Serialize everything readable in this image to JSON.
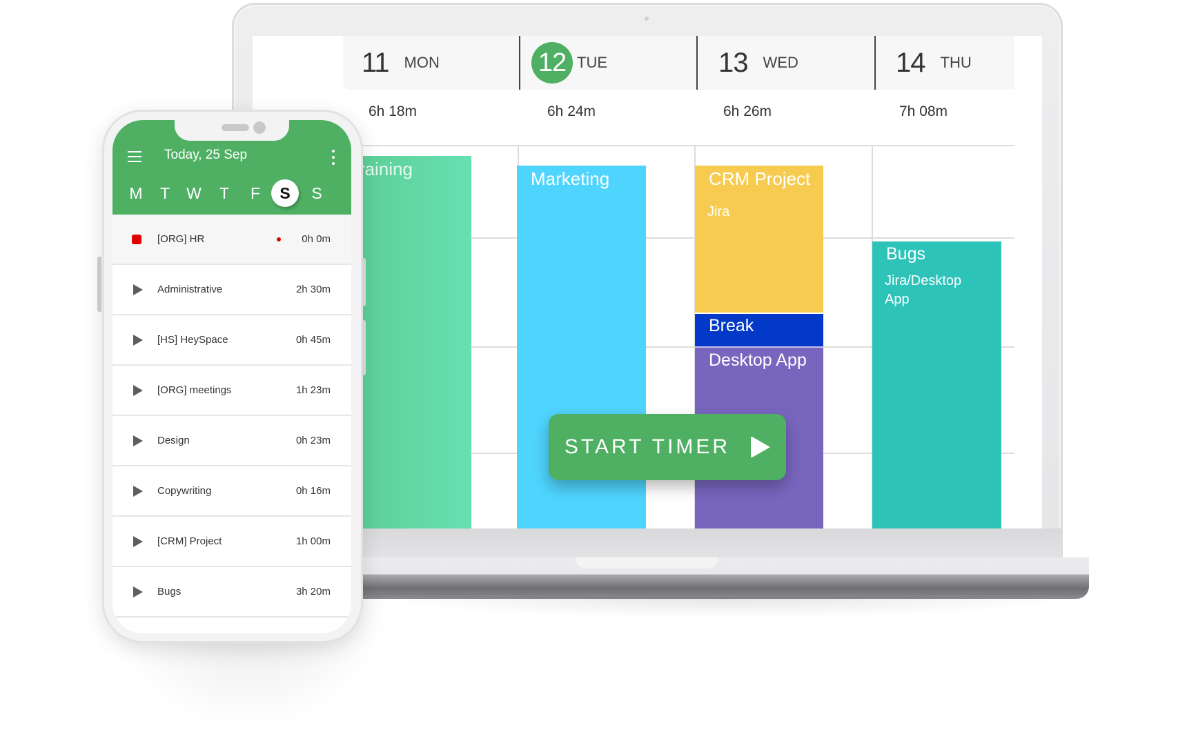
{
  "desktop": {
    "days": [
      {
        "num": "11",
        "name": "MON",
        "duration": "6h 18m",
        "today": false
      },
      {
        "num": "12",
        "name": "TUE",
        "duration": "6h 24m",
        "today": true
      },
      {
        "num": "13",
        "name": "WED",
        "duration": "6h 26m",
        "today": false
      },
      {
        "num": "14",
        "name": "THU",
        "duration": "7h 08m",
        "today": false
      }
    ],
    "blocks": [
      {
        "title": "Training",
        "subtitle": "",
        "color": "#67e0b0"
      },
      {
        "title": "Marketing",
        "subtitle": "",
        "color": "#4fd4fe"
      },
      {
        "title": "CRM Project",
        "subtitle": "Jira",
        "color": "#f6cb4f"
      },
      {
        "title": "Break",
        "subtitle": "",
        "color": "#0339c8"
      },
      {
        "title": "Desktop App",
        "subtitle": "",
        "color": "#7866be"
      },
      {
        "title": "Bugs",
        "subtitle": "Jira/Desktop App",
        "color": "#2dc3b8"
      }
    ],
    "start_timer_label": "START TIMER"
  },
  "mobile": {
    "title": "Today, 25 Sep",
    "weekdays": [
      "M",
      "T",
      "W",
      "T",
      "F",
      "S",
      "S"
    ],
    "selected_weekday_index": 5,
    "tasks": [
      {
        "name": "[ORG] HR",
        "time": "0h 0m",
        "running": true
      },
      {
        "name": "Administrative",
        "time": "2h 30m",
        "running": false
      },
      {
        "name": "[HS] HeySpace",
        "time": "0h 45m",
        "running": false
      },
      {
        "name": "[ORG] meetings",
        "time": "1h 23m",
        "running": false
      },
      {
        "name": "Design",
        "time": "0h 23m",
        "running": false
      },
      {
        "name": "Copywriting",
        "time": "0h 16m",
        "running": false
      },
      {
        "name": "[CRM] Project",
        "time": "1h 00m",
        "running": false
      },
      {
        "name": "Bugs",
        "time": "3h 20m",
        "running": false
      }
    ]
  },
  "colors": {
    "brand_green": "#4fb064",
    "recording_red": "#e00000"
  }
}
